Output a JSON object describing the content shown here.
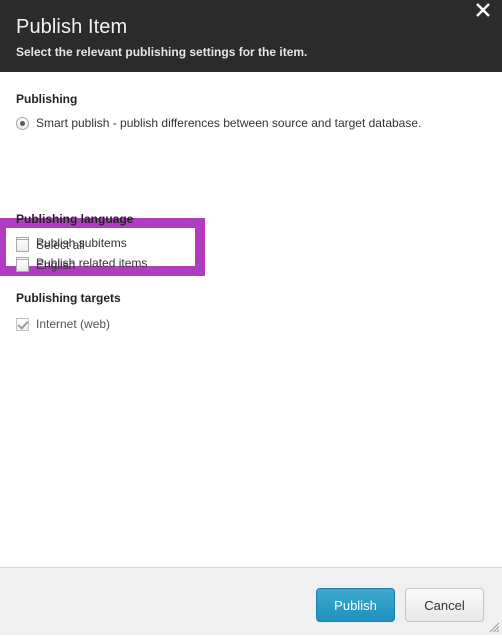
{
  "dialog": {
    "title": "Publish Item",
    "subtitle": "Select the relevant publishing settings for the item.",
    "close_icon": "close-icon"
  },
  "sections": [
    {
      "heading": "Publishing",
      "options": [
        {
          "type": "radio",
          "label": "Smart publish - publish differences between source and target database.",
          "checked": true,
          "disabled": false
        }
      ]
    },
    {
      "heading": "",
      "highlighted": true,
      "options": [
        {
          "type": "checkbox",
          "label": "Publish subitems",
          "checked": true,
          "disabled": false
        },
        {
          "type": "checkbox",
          "label": "Publish related items",
          "checked": true,
          "disabled": false
        }
      ]
    },
    {
      "heading": "Publishing language",
      "options": [
        {
          "type": "checkbox",
          "label": "Select all",
          "checked": false,
          "disabled": false
        },
        {
          "type": "checkbox",
          "label": "English",
          "checked": false,
          "disabled": false
        }
      ]
    },
    {
      "heading": "Publishing targets",
      "options": [
        {
          "type": "checkbox",
          "label": "Internet (web)",
          "checked": true,
          "disabled": true
        }
      ]
    }
  ],
  "footer": {
    "publish_label": "Publish",
    "cancel_label": "Cancel",
    "resize_grip_icon": "resize-grip-icon"
  },
  "colors": {
    "header_background": "#2b2b2b",
    "highlight_annotation": "#b13cc0",
    "primary_button": "#1f91bb",
    "footer_background": "#f0f0f0"
  }
}
